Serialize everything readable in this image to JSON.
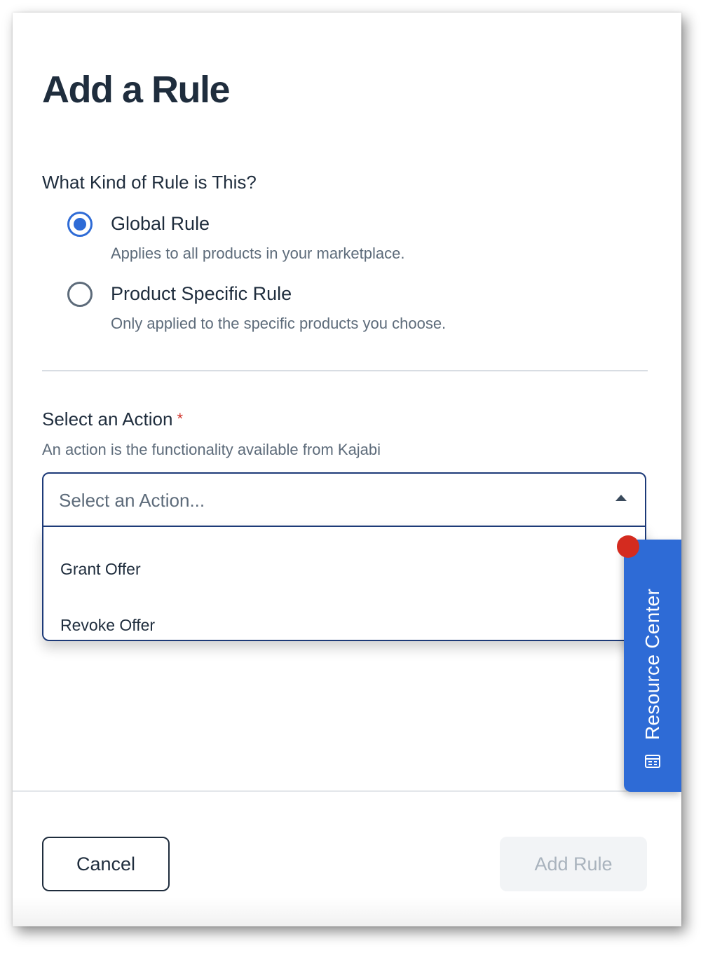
{
  "modal": {
    "title": "Add a Rule"
  },
  "rule_type": {
    "question": "What Kind of Rule is This?",
    "options": [
      {
        "label": "Global Rule",
        "description": "Applies to all products in your marketplace.",
        "selected": true
      },
      {
        "label": "Product Specific Rule",
        "description": "Only applied to the specific products you choose.",
        "selected": false
      }
    ]
  },
  "action": {
    "label": "Select an Action",
    "required_marker": "*",
    "help": "An action is the functionality available from Kajabi",
    "placeholder": "Select an Action...",
    "dropdown_open": true,
    "options": [
      "Grant Offer",
      "Revoke Offer"
    ]
  },
  "resource_center": {
    "label": "Resource Center",
    "icon": "resource-center-icon",
    "notification_dot": true
  },
  "footer": {
    "cancel_label": "Cancel",
    "add_label": "Add Rule",
    "add_disabled": true
  },
  "colors": {
    "accent": "#2e6bd6",
    "text": "#1f2d3d",
    "muted": "#5d6b7a",
    "required": "#d0342c",
    "notification": "#d42b1f",
    "disabled_bg": "#f2f4f6",
    "disabled_text": "#a9b3bd"
  }
}
